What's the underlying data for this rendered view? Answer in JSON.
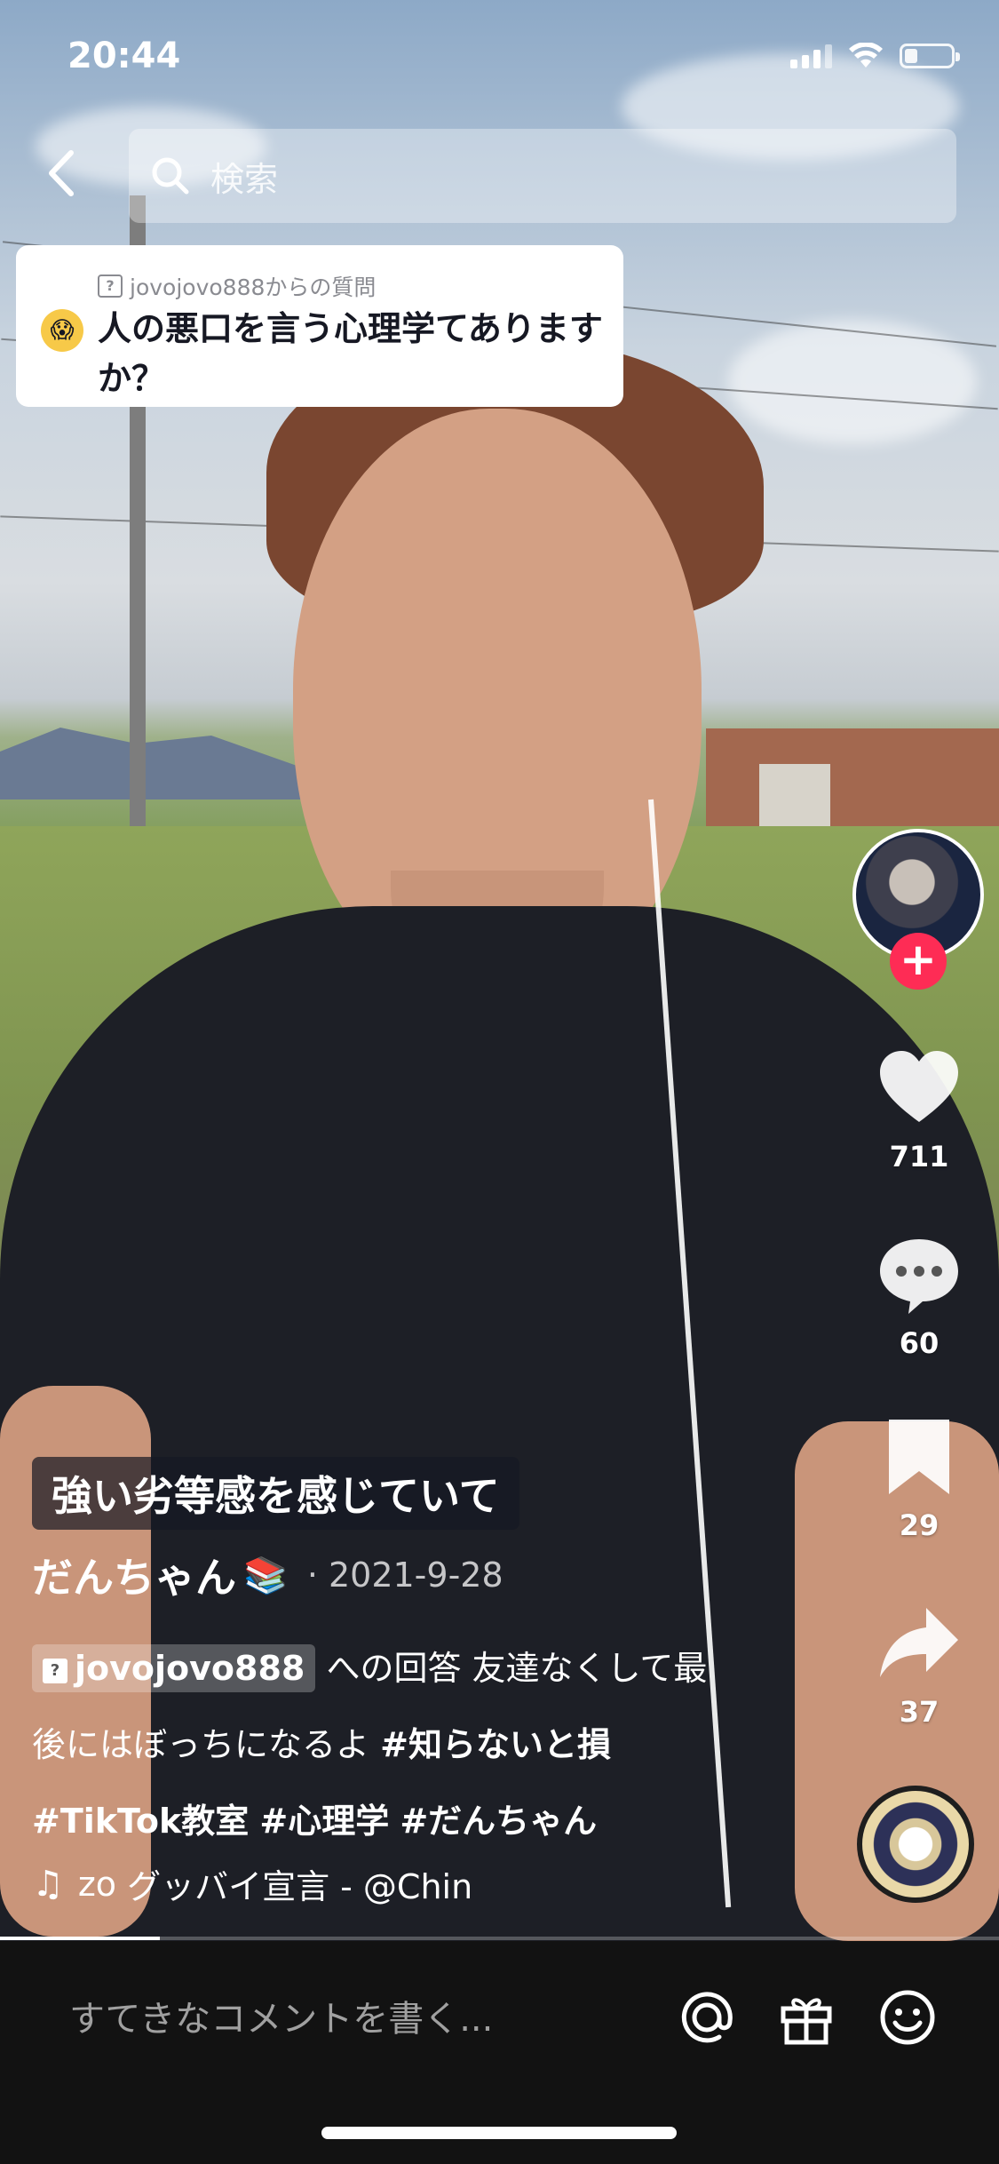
{
  "status_bar": {
    "time": "20:44"
  },
  "search": {
    "placeholder": "検索"
  },
  "question_card": {
    "from": "jovojovo888からの質問",
    "question": "人の悪口を言う心理学てありますか？"
  },
  "rail": {
    "likes": "711",
    "comments": "60",
    "bookmarks": "29",
    "shares": "37"
  },
  "video": {
    "highlight_label": "強い劣等感を感じていて",
    "author": "だんちゃん",
    "author_emoji": "📚",
    "date": "· 2021-9-28",
    "mention": "jovojovo888",
    "caption_plain": "への回答  友達なくして最後にはぼっちになるよ",
    "hashtags": [
      "#知らないと損",
      "#TikTok教室",
      "#心理学",
      "#だんちゃん"
    ],
    "music_prefix": "zo",
    "music_title": "グッバイ宣言 - @Chin",
    "progress": 0.16
  },
  "bottom": {
    "comment_placeholder": "すてきなコメントを書く..."
  }
}
